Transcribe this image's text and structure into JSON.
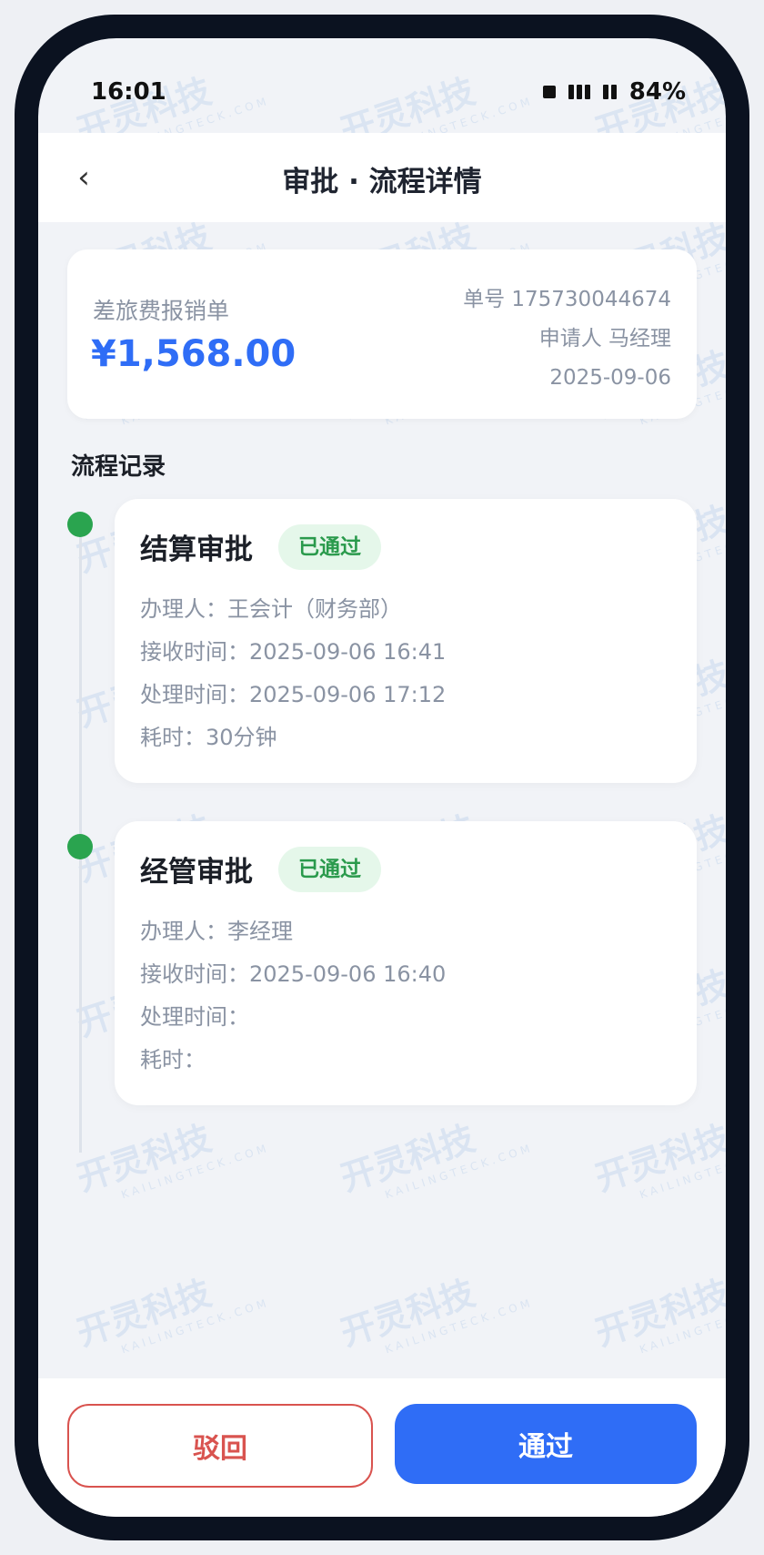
{
  "status_bar": {
    "time": "16:01",
    "battery": "84%"
  },
  "nav": {
    "back_icon": "‹",
    "title": "审批 · 流程详情"
  },
  "summary": {
    "type": "差旅费报销单",
    "amount": "¥1,568.00",
    "order_no": "单号 175730044674",
    "applicant": "申请人 马经理",
    "date": "2025-09-06"
  },
  "section_title": "流程记录",
  "steps": [
    {
      "name": "结算审批",
      "status": "已通过",
      "handler": "办理人：王会计（财务部）",
      "received": "接收时间：2025-09-06 16:41",
      "processed": "处理时间：2025-09-06 17:12",
      "duration": "耗时：30分钟"
    },
    {
      "name": "经管审批",
      "status": "已通过",
      "handler": "办理人：李经理",
      "received": "接收时间：2025-09-06 16:40",
      "processed": "处理时间：",
      "duration": "耗时："
    }
  ],
  "actions": {
    "reject": "驳回",
    "approve": "通过"
  },
  "watermark": {
    "text": "开灵科技",
    "sub": "KAILINGTECK.COM"
  },
  "colors": {
    "accent": "#2f6df6",
    "success": "#2aa44f",
    "danger": "#d9534f"
  }
}
